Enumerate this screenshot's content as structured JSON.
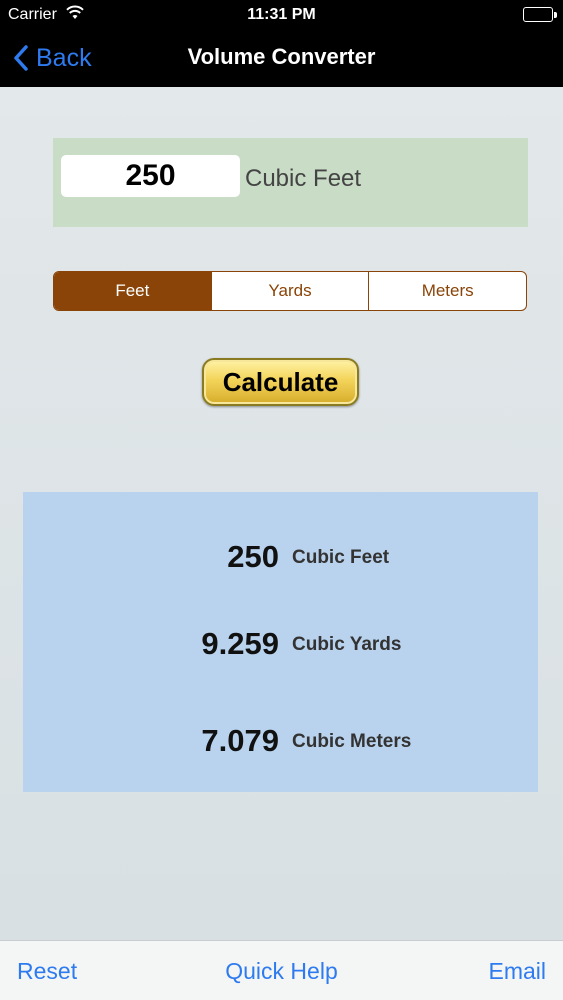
{
  "status": {
    "carrier": "Carrier",
    "time": "11:31 PM"
  },
  "nav": {
    "back_label": "Back",
    "title": "Volume Converter"
  },
  "input": {
    "value": "250",
    "unit_label": "Cubic Feet"
  },
  "units": {
    "options": [
      "Feet",
      "Yards",
      "Meters"
    ],
    "selected": "Feet"
  },
  "calculate_label": "Calculate",
  "results": [
    {
      "value": "250",
      "unit": "Cubic Feet"
    },
    {
      "value": "9.259",
      "unit": "Cubic Yards"
    },
    {
      "value": "7.079",
      "unit": "Cubic Meters"
    }
  ],
  "toolbar": {
    "reset": "Reset",
    "help": "Quick Help",
    "email": "Email"
  },
  "colors": {
    "accent": "#2e7bf0",
    "segment": "#8a4408",
    "input_panel": "#c8dcc6",
    "results_panel": "#b9d3ee"
  }
}
